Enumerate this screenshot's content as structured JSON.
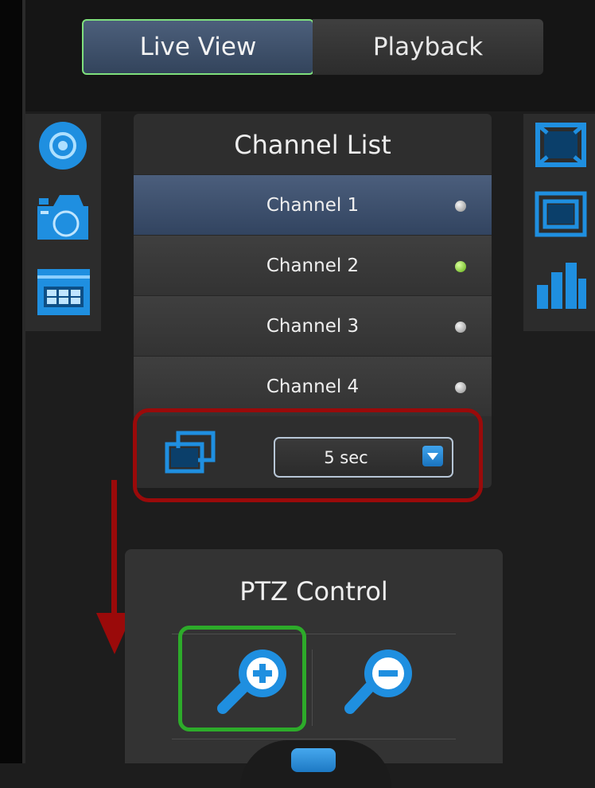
{
  "tabs": {
    "live_view": "Live View",
    "playback": "Playback"
  },
  "left_toolbar": {
    "icons": [
      "record-icon",
      "camera-icon",
      "grid-layout-icon"
    ]
  },
  "right_toolbar": {
    "icons": [
      "fullscreen-icon",
      "window-fit-icon",
      "stats-icon"
    ]
  },
  "channel_list": {
    "title": "Channel List",
    "channels": [
      {
        "label": "Channel 1",
        "status": "offline",
        "selected": true
      },
      {
        "label": "Channel 2",
        "status": "online",
        "selected": false
      },
      {
        "label": "Channel 3",
        "status": "offline",
        "selected": false
      },
      {
        "label": "Channel 4",
        "status": "offline",
        "selected": false
      }
    ],
    "sequence": {
      "icon": "sequence-icon",
      "interval_value": "5 sec"
    }
  },
  "ptz": {
    "title": "PTZ Control",
    "zoom_in_icon": "zoom-in-icon",
    "zoom_out_icon": "zoom-out-icon"
  },
  "colors": {
    "accent_blue": "#1f8fe0",
    "highlight_green": "#2dab2a",
    "annotation_red": "#9a0a0a",
    "status_online": "#6bc21a",
    "status_offline": "#bdbdbd"
  }
}
